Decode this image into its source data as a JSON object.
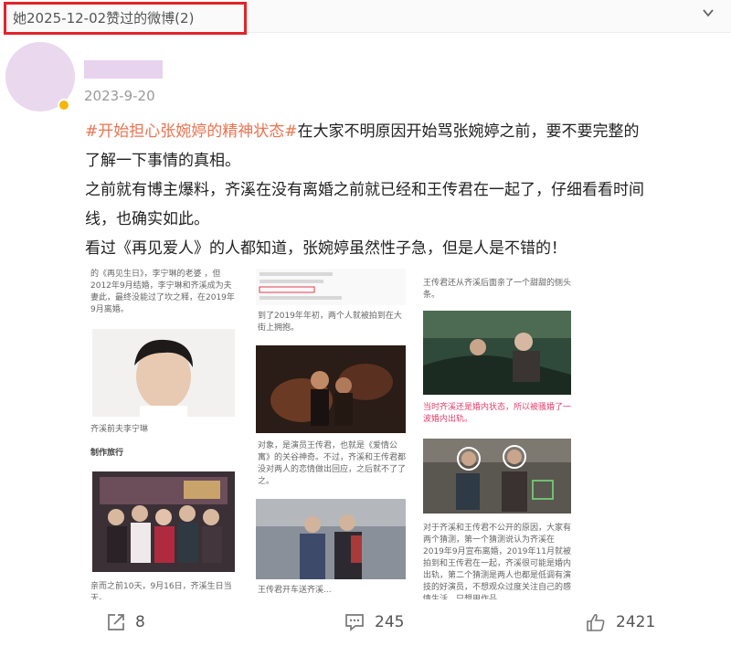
{
  "header": {
    "title": "她2025-12-02赞过的微博(2)"
  },
  "post": {
    "date": "2023-9-20",
    "hashtag": "#开始担心张婉婷的精神状态#",
    "line1_rest": "在大家不明原因开始骂张婉婷之前，要不要完整的",
    "line2": "了解一下事情的真相。",
    "line3": "之前就有博主爆料，齐溪在没有离婚之前就已经和王传君在一起了，仔细看看时间",
    "line4": "线，也确实如此。",
    "line5": "看过《再见爱人》的人都知道，张婉婷虽然性子急，但是人是不错的！"
  },
  "images": {
    "col1": {
      "cap_top": "的《再见生日》，李宁琳的老婆 ，但2012年9月结婚，李宁琳和齐溪成为夫妻此，最终没能过了坎之释，在2019年9月离婚。",
      "cap_mid": "齐溪前夫李宁琳",
      "subhead": "制作旅行",
      "cap_bottom": "亲而之前10天，9月16日，齐溪生日当天。"
    },
    "col2": {
      "cap_top": "到了2019年年初，两个人就被拍到在大街上拥抱。",
      "cap_mid": "对象，是演员王传君，也就是《爱情公寓》的关谷神奇。不过，齐溪和王传君都没对两人的恋情做出回应，之后就不了了之。",
      "cap_bottom": "王传君开车送齐溪..."
    },
    "col3": {
      "cap_top": "王传君还从齐溪后面亲了一个甜甜的侧头条。",
      "cap_pink": "当时齐溪还是婚内状态，所以被骚婚了一波婚内出轨。",
      "cap_bottom": "对于齐溪和王传君不公开的原因，大家有两个猜测，第一个猜测说认为齐溪在2019年9月宣布离婚，2019年11月就被拍到和王传君在一起，齐溪很可能是婚内出轨，第二个猜测是两人也都是低调有演技的好演员，不想观众过度关注自己的感情生活，只想用作品"
    }
  },
  "actions": {
    "share_count": "8",
    "comment_count": "245",
    "like_count": "2421"
  },
  "icons": [
    "chevron-down-icon",
    "verified-badge-icon",
    "share-icon",
    "comment-icon",
    "like-icon"
  ],
  "colors": {
    "hashtag": "#eb7350",
    "highlight_box": "#e0242a",
    "verified": "#f5b70a",
    "avatar": "#e9d8ee"
  }
}
